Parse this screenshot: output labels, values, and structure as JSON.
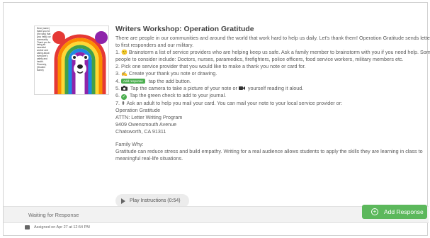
{
  "activity": {
    "thumbnail_text": "Dear (name) thank you for (the way) that (you help) our community. Thank you for being an essential worker and caring about everyone's safety and health. Sincerely, (Student Name)",
    "title": "Writers Workshop: Operation Gratitude",
    "intro_1": "There are people in our communities and around the world that work hard to help us daily. Let's thank them! Operation Gratitude sends letters",
    "intro_2": "to first responders and our military.",
    "step1a": "1. 🙂 Brainstorm a list of service providers who are helping keep us safe. Ask a family member to brainstorm with you if you need help. Some",
    "step1b": "people to consider include: Doctors, nurses, paramedics, firefighters, police officers, food service workers, military members etc.",
    "step2": "2. Pick one service provider that you would like to make a thank you note or card for.",
    "step3": "3. ✍ Create your thank you note or drawing.",
    "step4_num": "4.",
    "step4_chip": "Add response",
    "step4_rest": "tap the add button.",
    "step5_a": "5.",
    "step5_b": "Tap the camera to take a picture of your note or",
    "step5_c": "yourself reading it aloud.",
    "step6_a": "6.",
    "step6_b": "Tap the green check to add to your journal.",
    "step7": "7. ⬍ Ask an adult to help you mail your card. You can mail your note to your local service provider or:",
    "addr1": "Operation Gratitude",
    "addr2": "ATTN: Letter Writing Program",
    "addr3": "9409 Owensmouth Avenue",
    "addr4": "Chatsworth, CA 91311",
    "family_why": "Family Why:",
    "why1": "Gratitude can reduce stress and build empathy. Writing for a real audience allows students to apply the skills they are learning in class to",
    "why2": "meaningful real-life situations.",
    "play_label": "Play Instructions (0:54)"
  },
  "status": {
    "text": "Waiting for Response",
    "add_label": "Add Response"
  },
  "assigned": "Assigned on Apr 27 at 12:54 PM",
  "colors": {
    "accent_green": "#5cb85c",
    "status_bg": "#f2f2f2"
  }
}
